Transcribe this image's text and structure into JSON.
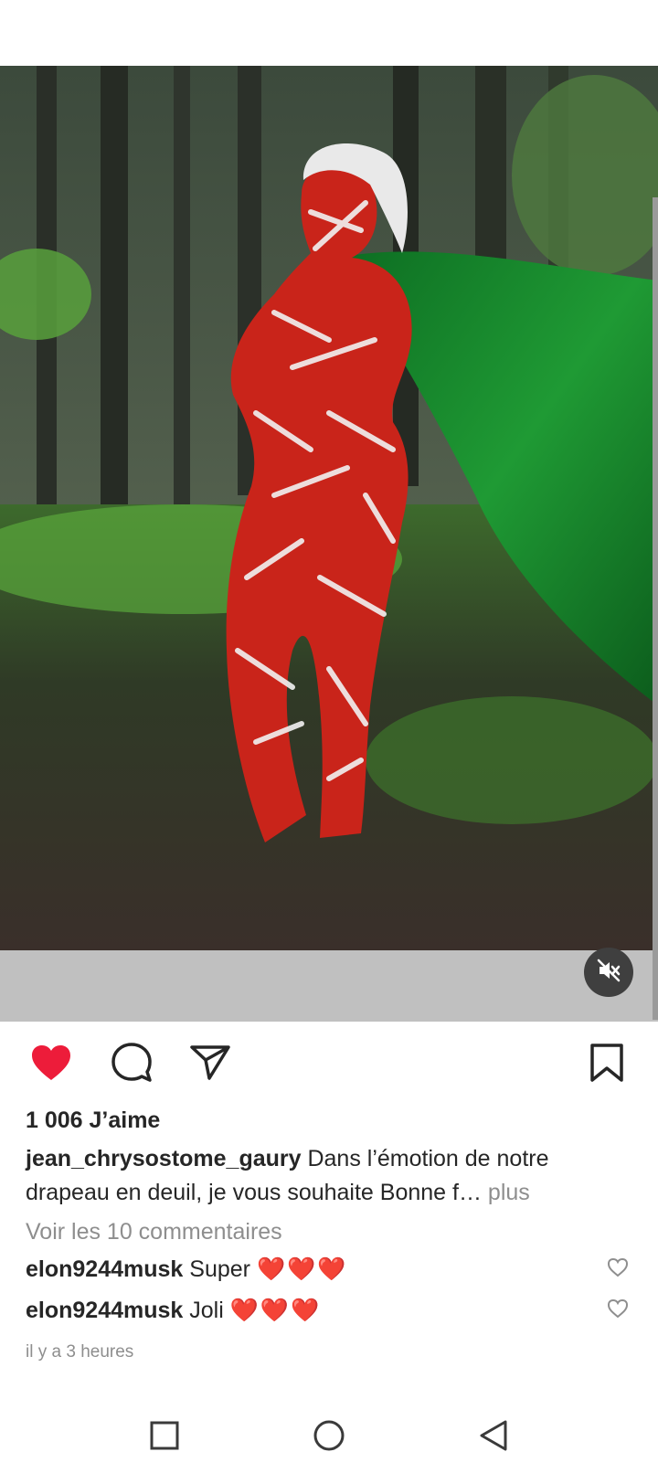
{
  "post": {
    "likes_text": "1 006 J’aime",
    "username": "jean_chrysostome_gaury",
    "caption_text": " Dans l’émotion de notre drapeau en deuil, je vous souhaite Bonne f…",
    "more_label": " plus",
    "view_comments_label": "Voir les 10 commentaires",
    "time_text": "il y a 3 heures",
    "liked": true
  },
  "comments": [
    {
      "user": "elon9244musk",
      "text": " Super ",
      "hearts": "❤️❤️❤️"
    },
    {
      "user": "elon9244musk",
      "text": " Joli ",
      "hearts": "❤️❤️❤️"
    }
  ],
  "icons": {
    "like": "heart-icon",
    "comment": "comment-icon",
    "share": "send-icon",
    "save": "bookmark-icon",
    "mute": "volume-muted-icon",
    "nav_recent": "square-icon",
    "nav_home": "circle-icon",
    "nav_back": "triangle-back-icon"
  },
  "colors": {
    "like_red": "#ed1c3a",
    "text": "#262626",
    "muted_text": "#8e8e8e",
    "flag_green": "#1f8a2c"
  }
}
